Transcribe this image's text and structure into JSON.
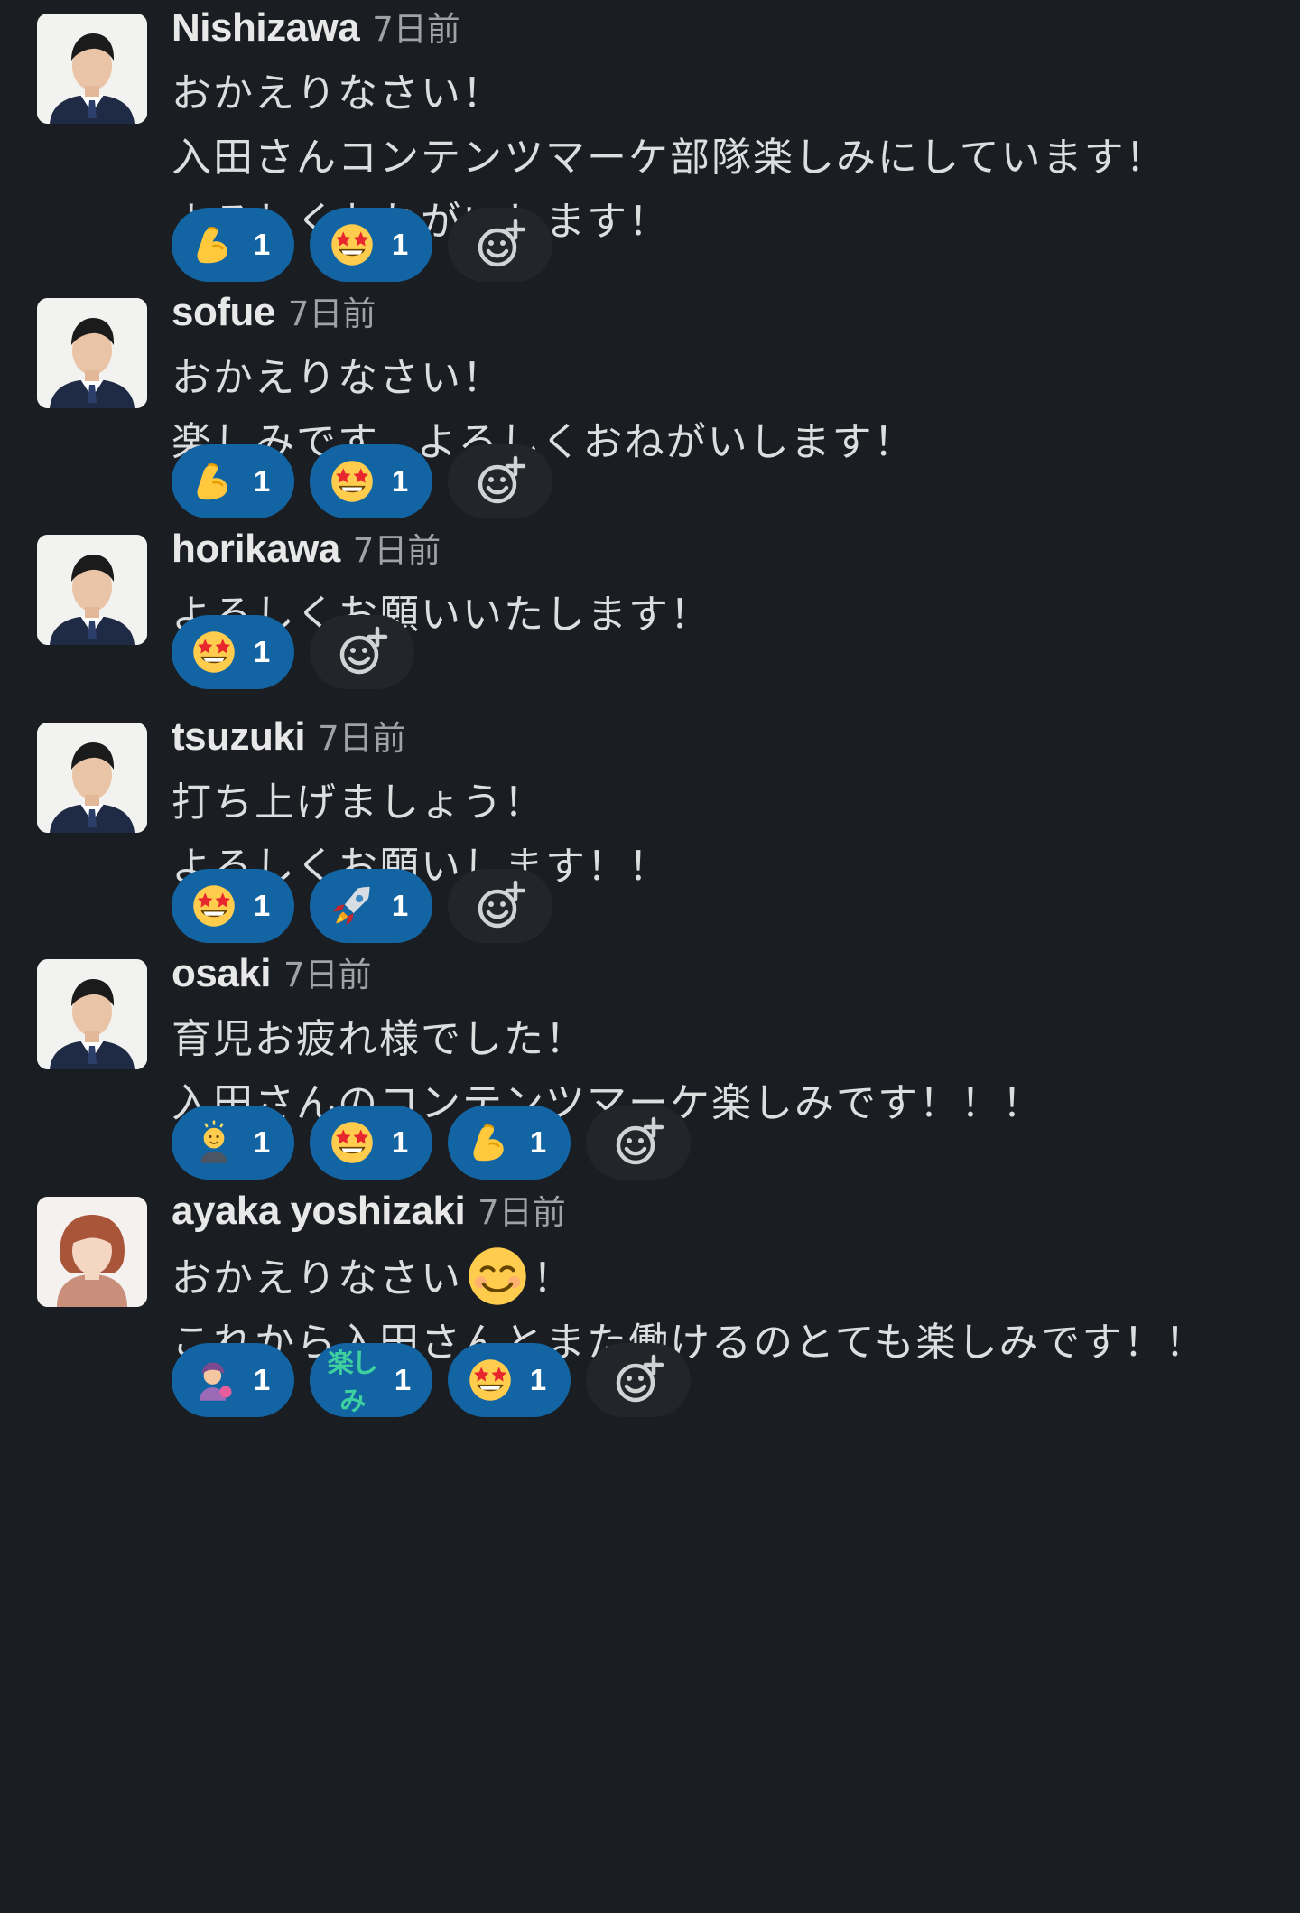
{
  "messages": [
    {
      "username": "Nishizawa",
      "timestamp": "7日前",
      "avatar_type": "man",
      "lines": [
        "おかえりなさい！",
        "入田さんコンテンツマーケ部隊楽しみにしています！",
        "よろしくおねがいします！"
      ],
      "reactions": [
        {
          "emoji": "muscle-emoji",
          "count": "1"
        },
        {
          "emoji": "star-struck-emoji",
          "count": "1"
        }
      ]
    },
    {
      "username": "sofue",
      "timestamp": "7日前",
      "avatar_type": "man",
      "lines": [
        "おかえりなさい！",
        "楽しみです。よろしくおねがいします！"
      ],
      "reactions": [
        {
          "emoji": "muscle-emoji",
          "count": "1"
        },
        {
          "emoji": "star-struck-emoji",
          "count": "1"
        }
      ]
    },
    {
      "username": "horikawa",
      "timestamp": "7日前",
      "avatar_type": "man",
      "lines": [
        "よろしくお願いいたします！"
      ],
      "reactions": [
        {
          "emoji": "star-struck-emoji",
          "count": "1"
        }
      ]
    },
    {
      "username": "tsuzuki",
      "timestamp": "7日前",
      "avatar_type": "man",
      "lines": [
        "打ち上げましょう！",
        "よろしくお願いします！！"
      ],
      "reactions": [
        {
          "emoji": "star-struck-emoji",
          "count": "1"
        },
        {
          "emoji": "rocket-emoji",
          "count": "1"
        }
      ]
    },
    {
      "username": "osaki",
      "timestamp": "7日前",
      "avatar_type": "man",
      "lines": [
        "育児お疲れ様でした！",
        "入田さんのコンテンツマーケ楽しみです！！！"
      ],
      "reactions": [
        {
          "emoji": "idea-person-emoji",
          "count": "1"
        },
        {
          "emoji": "star-struck-emoji",
          "count": "1"
        },
        {
          "emoji": "muscle-emoji",
          "count": "1"
        }
      ]
    },
    {
      "username": "ayaka yoshizaki",
      "timestamp": "7日前",
      "avatar_type": "woman",
      "lines": [
        "おかえりなさい{smile}！",
        "これから入田さんとまた働けるのとても楽しみです！！"
      ],
      "reactions": [
        {
          "emoji": "person-emoji",
          "count": "1"
        },
        {
          "emoji": "tanoshimi-text-emoji",
          "text": "楽しみ",
          "count": "1"
        },
        {
          "emoji": "star-struck-emoji",
          "count": "1"
        }
      ]
    }
  ],
  "add_reaction_icon": "add-reaction-icon",
  "colors": {
    "background": "#1a1d21",
    "reaction_bg": "#1264a3",
    "add_reaction_bg": "#222529",
    "timestamp": "#a0a3a6"
  }
}
